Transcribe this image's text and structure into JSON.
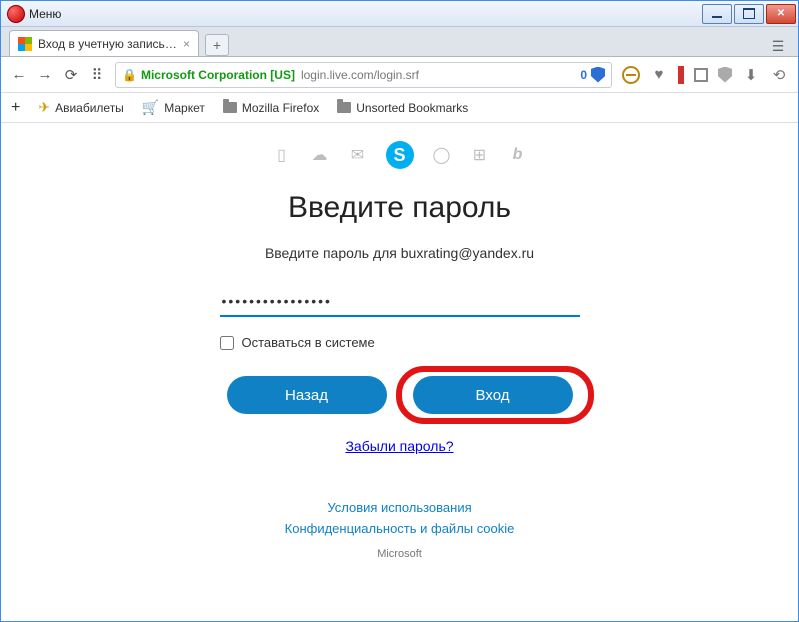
{
  "titlebar": {
    "menu": "Меню"
  },
  "tab": {
    "title": "Вход в учетную запись M..."
  },
  "address": {
    "cert": "Microsoft Corporation [US]",
    "url": "login.live.com/login.srf",
    "badge": "0"
  },
  "bookmarks": {
    "b1": "Авиабилеты",
    "b2": "Маркет",
    "b3": "Mozilla Firefox",
    "b4": "Unsorted Bookmarks"
  },
  "page": {
    "heading": "Введите пароль",
    "subheading": "Введите пароль для buxrating@yandex.ru",
    "password_masked": "••••••••••••••••",
    "stay_signed": "Оставаться в системе",
    "back": "Назад",
    "signin": "Вход",
    "forgot": "Забыли пароль?",
    "terms": "Условия использования",
    "privacy": "Конфиденциальность и файлы cookie",
    "ms": "Microsoft"
  }
}
